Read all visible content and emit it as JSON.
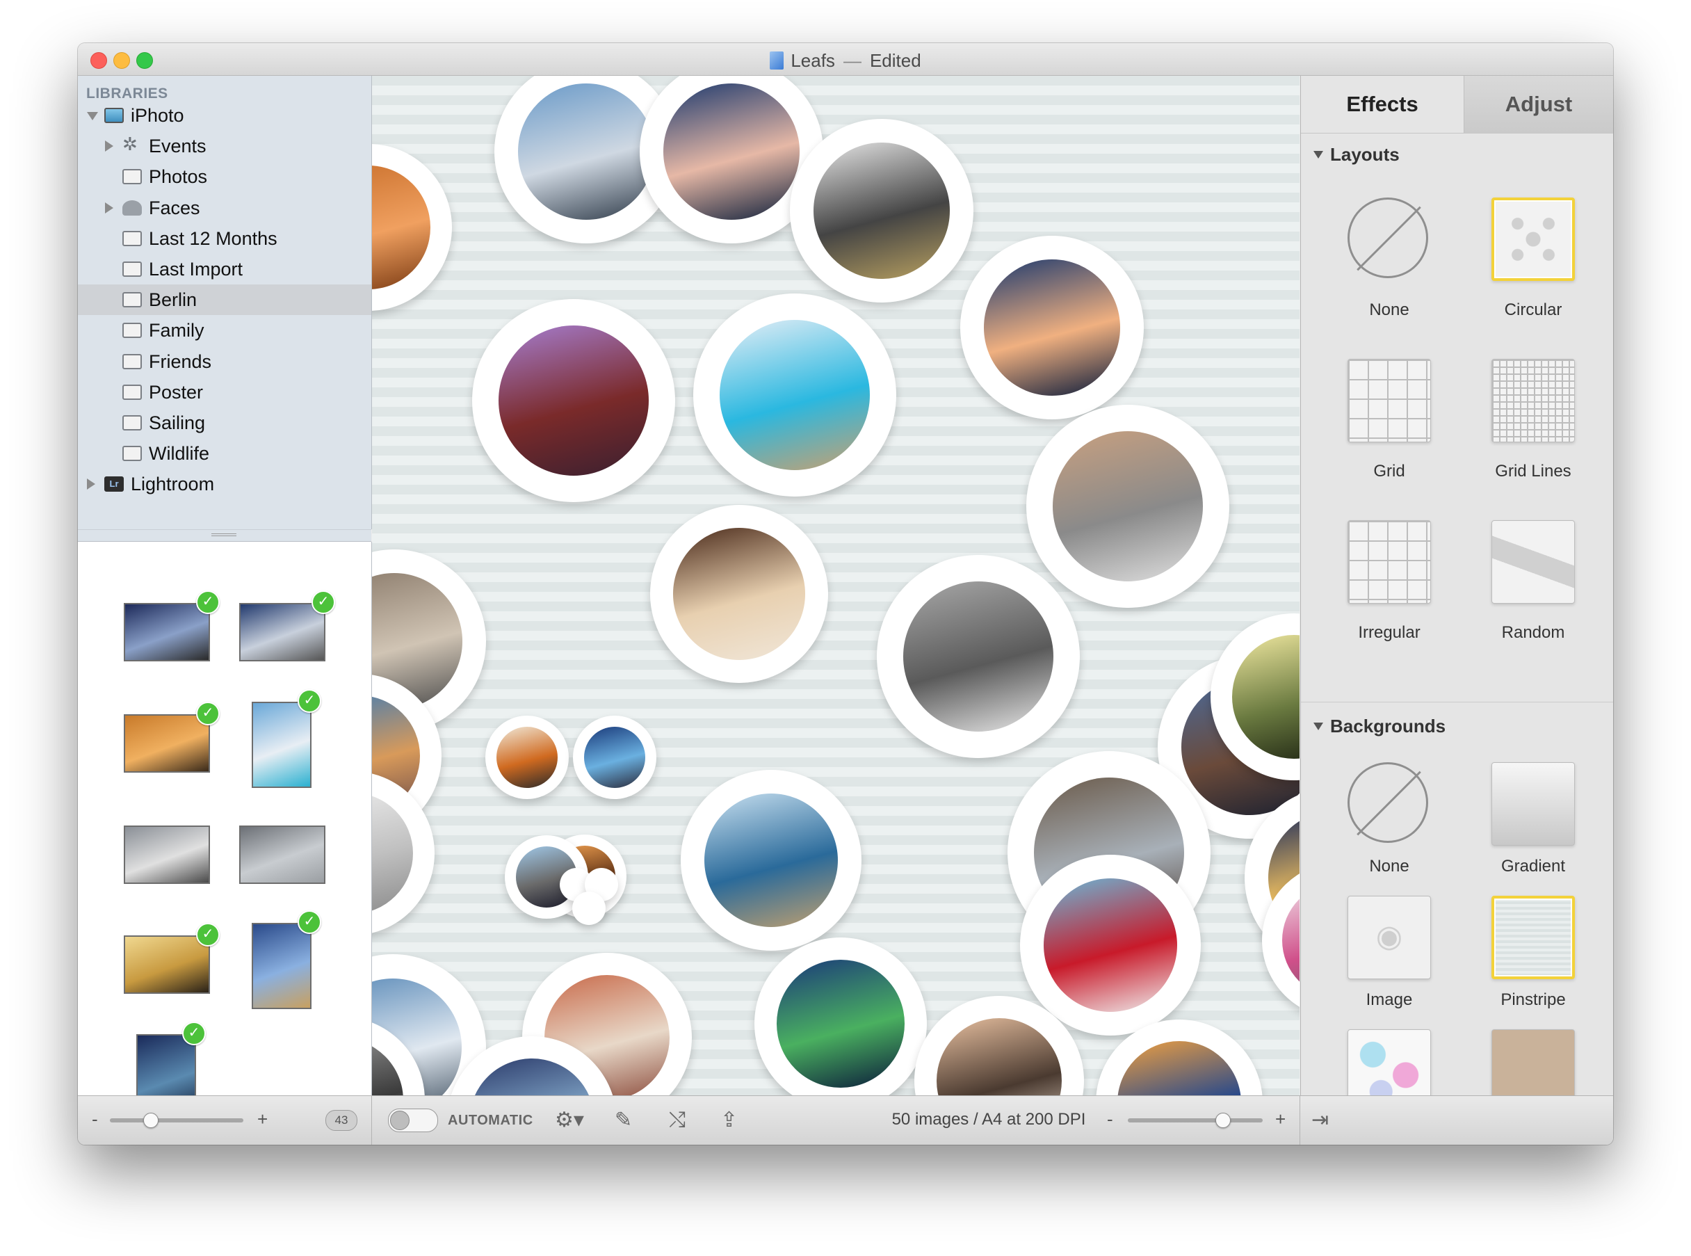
{
  "window": {
    "title": "Leafs",
    "title_separator": "—",
    "title_status": "Edited"
  },
  "sidebar": {
    "section_header": "LIBRARIES",
    "items": [
      {
        "label": "iPhoto",
        "icon": "iphoto-icon",
        "disclosure": "expanded"
      },
      {
        "label": "Events",
        "icon": "palm-tree-icon",
        "disclosure": "collapsed"
      },
      {
        "label": "Photos",
        "icon": "album-icon",
        "disclosure": "none"
      },
      {
        "label": "Faces",
        "icon": "person-icon",
        "disclosure": "collapsed"
      },
      {
        "label": "Last 12 Months",
        "icon": "calendar-icon",
        "disclosure": "none"
      },
      {
        "label": "Last Import",
        "icon": "album-icon",
        "disclosure": "none"
      },
      {
        "label": "Berlin",
        "icon": "album-icon",
        "disclosure": "none",
        "selected": true
      },
      {
        "label": "Family",
        "icon": "album-icon",
        "disclosure": "none"
      },
      {
        "label": "Friends",
        "icon": "album-icon",
        "disclosure": "none"
      },
      {
        "label": "Poster",
        "icon": "album-icon",
        "disclosure": "none"
      },
      {
        "label": "Sailing",
        "icon": "album-icon",
        "disclosure": "none"
      },
      {
        "label": "Wildlife",
        "icon": "album-icon",
        "disclosure": "none"
      },
      {
        "label": "Lightroom",
        "icon": "lightroom-icon",
        "icon_text": "Lr",
        "disclosure": "collapsed"
      }
    ]
  },
  "thumbnails": [
    {
      "checked": true,
      "colors": [
        "#1d2a5a",
        "#8aa0c8",
        "#2a2a2a"
      ]
    },
    {
      "checked": true,
      "colors": [
        "#223a6e",
        "#c8d0dc",
        "#555555"
      ]
    },
    {
      "checked": true,
      "colors": [
        "#c87a2a",
        "#f0b060",
        "#3a2a1a"
      ]
    },
    {
      "checked": true,
      "colors": [
        "#6aa8d8",
        "#e8eef4",
        "#2bb0d0"
      ]
    },
    {
      "checked": false,
      "colors": [
        "#8a8f96",
        "#e0e0e0",
        "#4a4a4a"
      ]
    },
    {
      "checked": false,
      "colors": [
        "#6c7076",
        "#c8ccd0",
        "#9a9ea2"
      ]
    },
    {
      "checked": true,
      "colors": [
        "#f0d890",
        "#c89a40",
        "#2a2218"
      ]
    },
    {
      "checked": true,
      "colors": [
        "#2a4a8a",
        "#8ab0e0",
        "#c8a060"
      ]
    },
    {
      "checked": true,
      "colors": [
        "#1a2a5a",
        "#5a8ab0",
        "#0a1530"
      ]
    }
  ],
  "canvas_photos": [
    {
      "c1": "#6a9ac8",
      "c2": "#cfd8e2",
      "c3": "#2e3a48"
    },
    {
      "c1": "#1e3a6e",
      "c2": "#e6b8a6",
      "c3": "#0f1f3a"
    },
    {
      "c1": "#e6e6e6",
      "c2": "#444444",
      "c3": "#b8a060"
    },
    {
      "c1": "#c86e2a",
      "c2": "#f0a060",
      "c3": "#7a3a12"
    },
    {
      "c1": "#a67ed0",
      "c2": "#7a2a2a",
      "c3": "#3a2030"
    },
    {
      "c1": "#e6eef6",
      "c2": "#2ab8e0",
      "c3": "#c8a070"
    },
    {
      "c1": "#1e3a6e",
      "c2": "#f0b080",
      "c3": "#0a1a3a"
    },
    {
      "c1": "#c8a080",
      "c2": "#8a8a8a",
      "c3": "#e0e0e0"
    },
    {
      "c1": "#8a7a6a",
      "c2": "#d0c4b4",
      "c3": "#4a4a4a"
    },
    {
      "c1": "#4a2a1a",
      "c2": "#e8d0b0",
      "c3": "#f0e6d8"
    },
    {
      "c1": "#a8a8a8",
      "c2": "#5a5a5a",
      "c3": "#e8e8e8"
    },
    {
      "c1": "#4a6a9a",
      "c2": "#6a4a3a",
      "c3": "#1a2030"
    },
    {
      "c1": "#3a7ab8",
      "c2": "#d89a5a",
      "c3": "#6a4a4a"
    },
    {
      "c1": "#6a5a4a",
      "c2": "#a8b0b8",
      "c3": "#4a3a30"
    },
    {
      "c1": "#f0e8a0",
      "c2": "#6a7a40",
      "c3": "#1a2010"
    },
    {
      "c1": "#1a2a5a",
      "c2": "#f0c060",
      "c3": "#0a0a1a"
    },
    {
      "c1": "#f0e8d8",
      "c2": "#d06a20",
      "c3": "#2a2a2a"
    },
    {
      "c1": "#1a3a7a",
      "c2": "#6ab0e0",
      "c3": "#2a2a3a"
    },
    {
      "c1": "#f0f0f0",
      "c2": "#c0c0c0",
      "c3": "#8a8a8a"
    },
    {
      "c1": "#f0a050",
      "c2": "#6a3a1a",
      "c3": "#2a1a10"
    },
    {
      "c1": "#c8e0f0",
      "c2": "#2a6a9a",
      "c3": "#c0a070"
    },
    {
      "c1": "#6ab8d8",
      "c2": "#c81a2a",
      "c3": "#f0f0f0"
    },
    {
      "c1": "#f0e0e8",
      "c2": "#d0508a",
      "c3": "#6a5a6a"
    },
    {
      "c1": "#5a8ab8",
      "c2": "#e0e8f0",
      "c3": "#3a4a5a"
    },
    {
      "c1": "#a0c8e8",
      "c2": "#6a6a6a",
      "c3": "#1a1a2a"
    },
    {
      "c1": "#c86a4a",
      "c2": "#e8d8c8",
      "c3": "#8a4a3a"
    },
    {
      "c1": "#1a3a7a",
      "c2": "#4ab060",
      "c3": "#0a1a3a"
    },
    {
      "c1": "#e8c0a0",
      "c2": "#4a3a30",
      "c3": "#f0e0d0"
    },
    {
      "c1": "#f0a040",
      "c2": "#2a4a8a",
      "c3": "#f0d090"
    },
    {
      "c1": "#a0a0a0",
      "c2": "#3a3a3a",
      "c3": "#e0e0e0"
    },
    {
      "c1": "#2a3a6a",
      "c2": "#8ab0d0",
      "c3": "#4a4a5a"
    }
  ],
  "inspector": {
    "tabs": [
      {
        "label": "Effects",
        "active": true
      },
      {
        "label": "Adjust",
        "active": false
      }
    ],
    "layouts": {
      "header": "Layouts",
      "options": [
        {
          "label": "None",
          "kind": "none",
          "selected": false
        },
        {
          "label": "Circular",
          "kind": "circular",
          "selected": true
        },
        {
          "label": "Grid",
          "kind": "grid",
          "selected": false
        },
        {
          "label": "Grid Lines",
          "kind": "gridlines",
          "selected": false
        },
        {
          "label": "Irregular",
          "kind": "irregular",
          "selected": false
        },
        {
          "label": "Random",
          "kind": "random",
          "selected": false
        }
      ]
    },
    "backgrounds": {
      "header": "Backgrounds",
      "options": [
        {
          "label": "None",
          "kind": "none",
          "selected": false
        },
        {
          "label": "Gradient",
          "kind": "gradient",
          "selected": false
        },
        {
          "label": "Image",
          "kind": "image",
          "selected": false
        },
        {
          "label": "Pinstripe",
          "kind": "pinstripe",
          "selected": true
        },
        {
          "label": "Polka Dots",
          "kind": "polka",
          "selected": false
        },
        {
          "label": "Solid Color",
          "kind": "solid",
          "selected": false,
          "color": "#c9b29a"
        }
      ]
    }
  },
  "bottombar": {
    "left_minus": "-",
    "left_plus": "+",
    "thumb_size_level": 0.3,
    "photo_count": "43",
    "automatic_label": "AUTOMATIC",
    "automatic_on": false,
    "icons": [
      "gear-menu-icon",
      "magic-wand-icon",
      "shuffle-icon",
      "share-icon"
    ],
    "status": "50 images / A4 at 200 DPI",
    "zoom_minus": "-",
    "zoom_plus": "+",
    "zoom_level": 0.7,
    "exit_icon": "exit-icon"
  },
  "colors": {
    "selection_yellow": "#f3d23a",
    "check_green": "#4cc23a",
    "canvas_stripe_a": "#dfe6e6",
    "canvas_stripe_b": "#ecf1f1"
  }
}
